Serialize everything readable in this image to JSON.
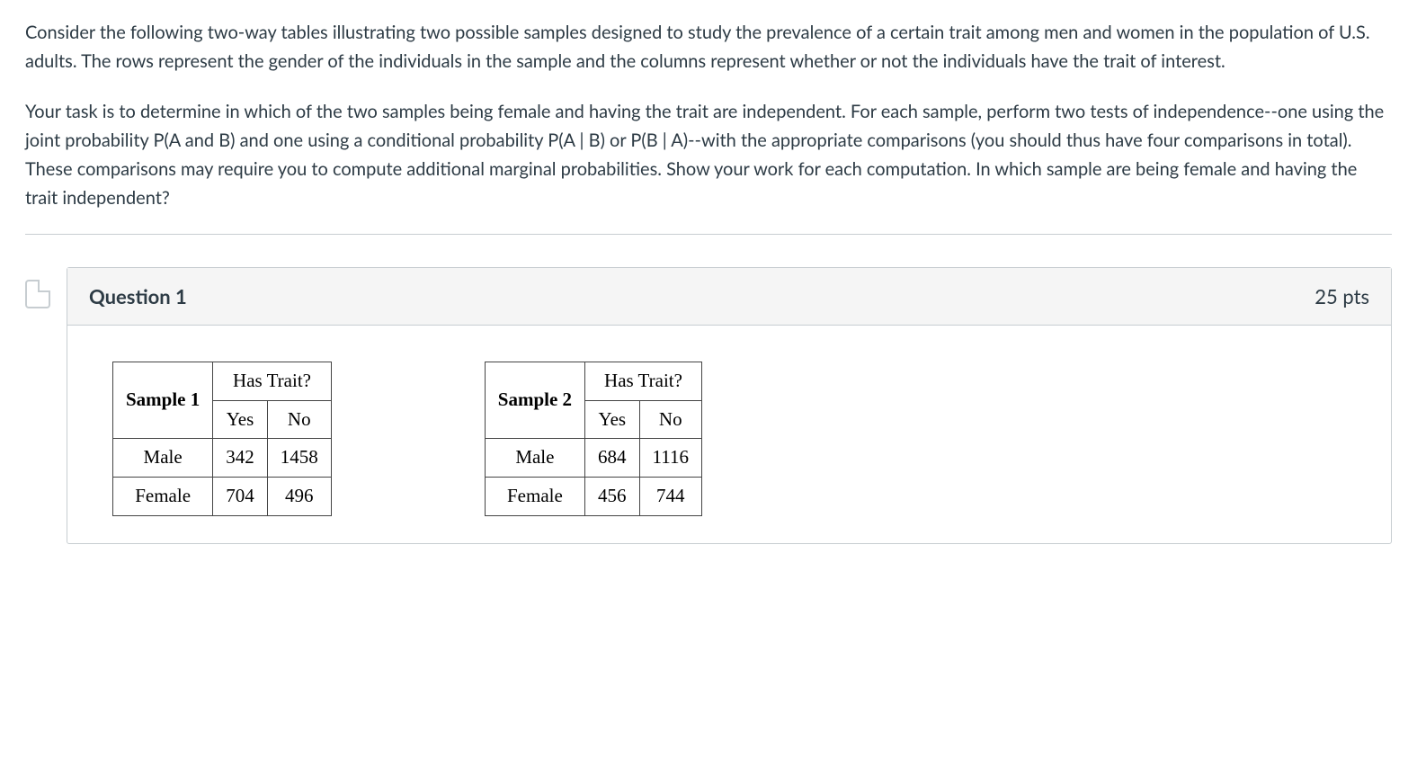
{
  "intro": {
    "p1": "Consider the following two-way tables illustrating two possible samples designed to study the prevalence of a certain trait among men and women in the population of U.S. adults. The rows represent the gender of the individuals in the sample and the columns represent whether or not the individuals have the trait of interest.",
    "p2": "Your task is to determine in which of the two samples being female and having the trait are independent. For each sample, perform two tests of independence--one using the joint probability P(A and B) and one using a conditional probability P(A | B) or P(B | A)--with the appropriate comparisons (you should thus have four comparisons in total). These comparisons may require you to compute additional marginal probabilities. Show your work for each computation. In which sample are being female and having the trait independent?"
  },
  "question": {
    "title": "Question 1",
    "points": "25 pts"
  },
  "tables": {
    "sample1": {
      "title": "Sample 1",
      "trait_header": "Has Trait?",
      "col_yes": "Yes",
      "col_no": "No",
      "rows": [
        {
          "label": "Male",
          "yes": "342",
          "no": "1458"
        },
        {
          "label": "Female",
          "yes": "704",
          "no": "496"
        }
      ]
    },
    "sample2": {
      "title": "Sample 2",
      "trait_header": "Has Trait?",
      "col_yes": "Yes",
      "col_no": "No",
      "rows": [
        {
          "label": "Male",
          "yes": "684",
          "no": "1116"
        },
        {
          "label": "Female",
          "yes": "456",
          "no": "744"
        }
      ]
    }
  }
}
